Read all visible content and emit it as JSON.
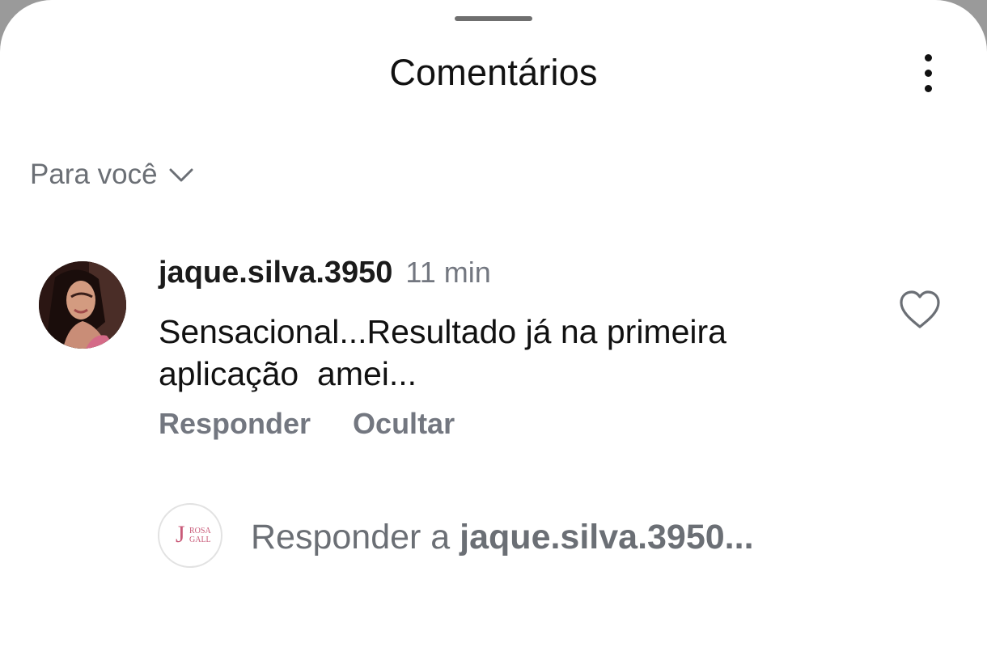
{
  "sheet": {
    "title": "Comentários"
  },
  "sort": {
    "label": "Para você"
  },
  "comment": {
    "username": "jaque.silva.3950",
    "time": "11 min",
    "text": "Sensacional...Resultado já na primeira aplicação  amei...",
    "actions": {
      "reply": "Responder",
      "hide": "Ocultar"
    }
  },
  "reply_box": {
    "prefix": "Responder a ",
    "target": "jaque.silva.3950",
    "suffix": "...",
    "avatar_logo": {
      "letter": "J",
      "line1": "ROSA",
      "line2": "GALL"
    }
  },
  "icons": {
    "more": "more-vertical-icon",
    "chevron": "chevron-down-icon",
    "like": "heart-outline-icon"
  },
  "colors": {
    "primary_text": "#111111",
    "secondary_text": "#737780",
    "logo": "#c85a78"
  }
}
